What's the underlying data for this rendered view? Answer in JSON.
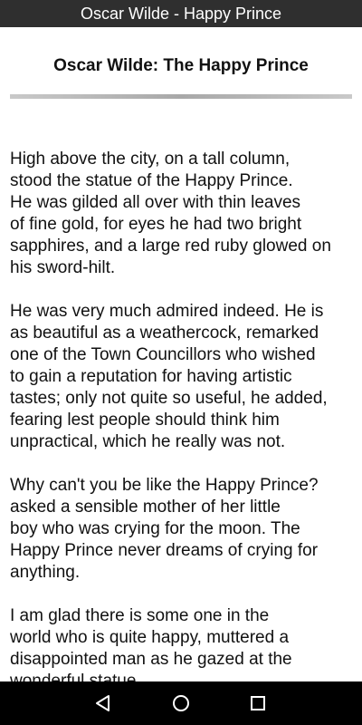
{
  "app_bar": {
    "title": "Oscar Wilde - Happy Prince"
  },
  "article": {
    "heading": "Oscar Wilde: The Happy Prince",
    "paragraphs": [
      [
        "High above the city, on a tall column,",
        "stood the statue of the Happy Prince.",
        "He was gilded all over with thin leaves",
        "of fine gold, for eyes he had two bright",
        "sapphires, and a large red ruby glowed on",
        "his sword-hilt."
      ],
      [
        "He was very much admired indeed. He is",
        "as beautiful as a weathercock, remarked",
        "one of the Town Councillors who wished",
        "to gain a reputation for having artistic",
        "tastes; only not quite so useful, he added,",
        "fearing lest people should think him",
        "unpractical, which he really was not."
      ],
      [
        "Why can't you be like the Happy Prince?",
        "asked a sensible mother of her little",
        "boy who was crying for the moon. The",
        "Happy Prince never dreams of crying for",
        "anything."
      ],
      [
        "I am glad there is some one in the",
        "world who is quite happy, muttered a",
        "disappointed man as he gazed at the",
        "wonderful statue."
      ]
    ]
  },
  "nav_bar": {
    "buttons": [
      "back-icon",
      "home-icon",
      "recents-icon"
    ]
  },
  "colors": {
    "app_bar": "#2f2f2f",
    "nav_bar": "#000000",
    "text": "#111111"
  }
}
